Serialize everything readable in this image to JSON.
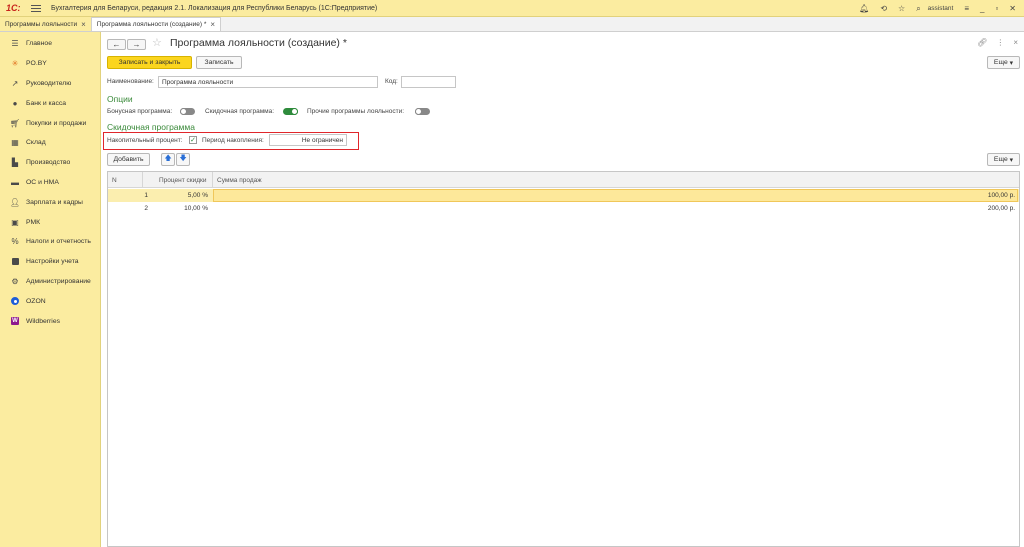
{
  "titlebar": {
    "logo": "1С:",
    "title": "Бухгалтерия для Беларуси, редакция 2.1. Локализация для Республики Беларусь   (1С:Предприятие)",
    "user": "assistant"
  },
  "tabs": [
    {
      "label": "Программы лояльности"
    },
    {
      "label": "Программа лояльности (создание) *"
    }
  ],
  "sidebar": {
    "items": [
      {
        "label": "Главное",
        "icon": "menu-icon"
      },
      {
        "label": "PO.BY",
        "icon": "asterisk-icon"
      },
      {
        "label": "Руководителю",
        "icon": "trend-icon"
      },
      {
        "label": "Банк и касса",
        "icon": "coins-icon"
      },
      {
        "label": "Покупки и продажи",
        "icon": "cart-icon"
      },
      {
        "label": "Склад",
        "icon": "warehouse-icon"
      },
      {
        "label": "Производство",
        "icon": "factory-icon"
      },
      {
        "label": "ОС и НМА",
        "icon": "truck-icon"
      },
      {
        "label": "Зарплата и кадры",
        "icon": "person-icon"
      },
      {
        "label": "РМК",
        "icon": "cashbox-icon"
      },
      {
        "label": "Налоги и отчетность",
        "icon": "percent-icon"
      },
      {
        "label": "Настройки учета",
        "icon": "settings-doc-icon"
      },
      {
        "label": "Администрирование",
        "icon": "gear-icon"
      },
      {
        "label": "OZON",
        "icon": "ozon-icon"
      },
      {
        "label": "Wildberries",
        "icon": "wildberries-icon"
      }
    ]
  },
  "form": {
    "title": "Программа лояльности (создание) *",
    "save_close": "Записать и закрыть",
    "save": "Записать",
    "more": "Еще",
    "name_label": "Наименование:",
    "name_value": "Программа лояльности",
    "code_label": "Код:",
    "code_value": "",
    "options_title": "Опции",
    "bonus_label": "Бонусная программа:",
    "discount_label": "Скидочная программа:",
    "other_label": "Прочие программы лояльности:",
    "discount_section": "Скидочная программа",
    "cumulative_label": "Накопительный процент:",
    "period_label": "Период накопления:",
    "period_value": "Не ограничен",
    "add_label": "Добавить",
    "table_more": "Еще"
  },
  "table": {
    "headers": [
      "N",
      "Процент скидки",
      "Сумма продаж"
    ],
    "rows": [
      {
        "n": "1",
        "percent": "5,00 %",
        "sum": "100,00 р."
      },
      {
        "n": "2",
        "percent": "10,00 %",
        "sum": "200,00 р."
      }
    ]
  },
  "colors": {
    "accent_yellow": "#fbeca0",
    "primary_button": "#fbd51e",
    "section_green": "#3a8a3a",
    "highlight_red": "#e0262b"
  }
}
